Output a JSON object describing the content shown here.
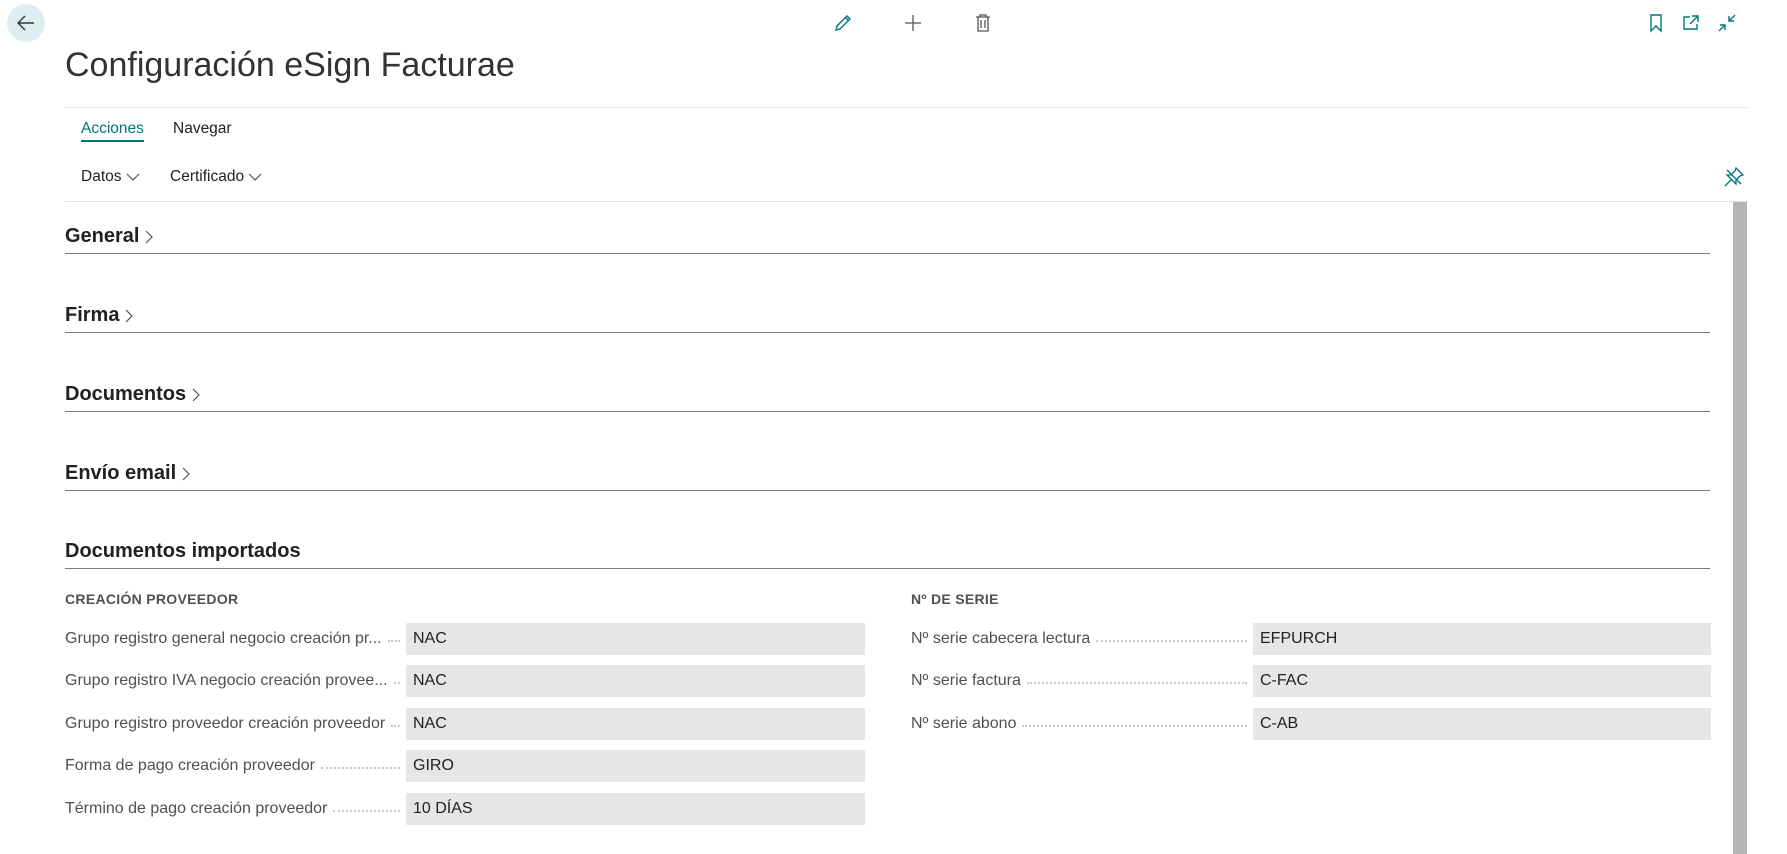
{
  "page": {
    "title": "Configuración eSign Facturae"
  },
  "menu": {
    "tabs": [
      {
        "label": "Acciones"
      },
      {
        "label": "Navegar"
      }
    ],
    "actions": [
      {
        "label": "Datos"
      },
      {
        "label": "Certificado"
      }
    ]
  },
  "sections": [
    {
      "label": "General"
    },
    {
      "label": "Firma"
    },
    {
      "label": "Documentos"
    },
    {
      "label": "Envío email"
    },
    {
      "label": "Documentos importados"
    }
  ],
  "imported": {
    "left_group": {
      "title": "CREACIÓN PROVEEDOR",
      "fields": [
        {
          "label": "Grupo registro general negocio creación pr...",
          "value": "NAC"
        },
        {
          "label": "Grupo registro IVA negocio creación provee...",
          "value": "NAC"
        },
        {
          "label": "Grupo registro proveedor creación proveedor",
          "value": "NAC"
        },
        {
          "label": "Forma de pago creación proveedor",
          "value": "GIRO"
        },
        {
          "label": "Término de pago creación proveedor",
          "value": "10 DÍAS"
        }
      ]
    },
    "right_group": {
      "title": "Nº DE SERIE",
      "fields": [
        {
          "label": "Nº serie cabecera lectura",
          "value": "EFPURCH"
        },
        {
          "label": "Nº serie factura",
          "value": "C-FAC"
        },
        {
          "label": "Nº serie abono",
          "value": "C-AB"
        }
      ]
    }
  },
  "colors": {
    "accent": "#00757f",
    "field_bg": "#e6e6e7"
  },
  "icons": [
    "back-arrow-icon",
    "edit-icon",
    "add-icon",
    "delete-icon",
    "bookmark-icon",
    "open-new-window-icon",
    "collapse-icon",
    "pin-icon",
    "chevron-down-icon",
    "chevron-right-icon"
  ]
}
